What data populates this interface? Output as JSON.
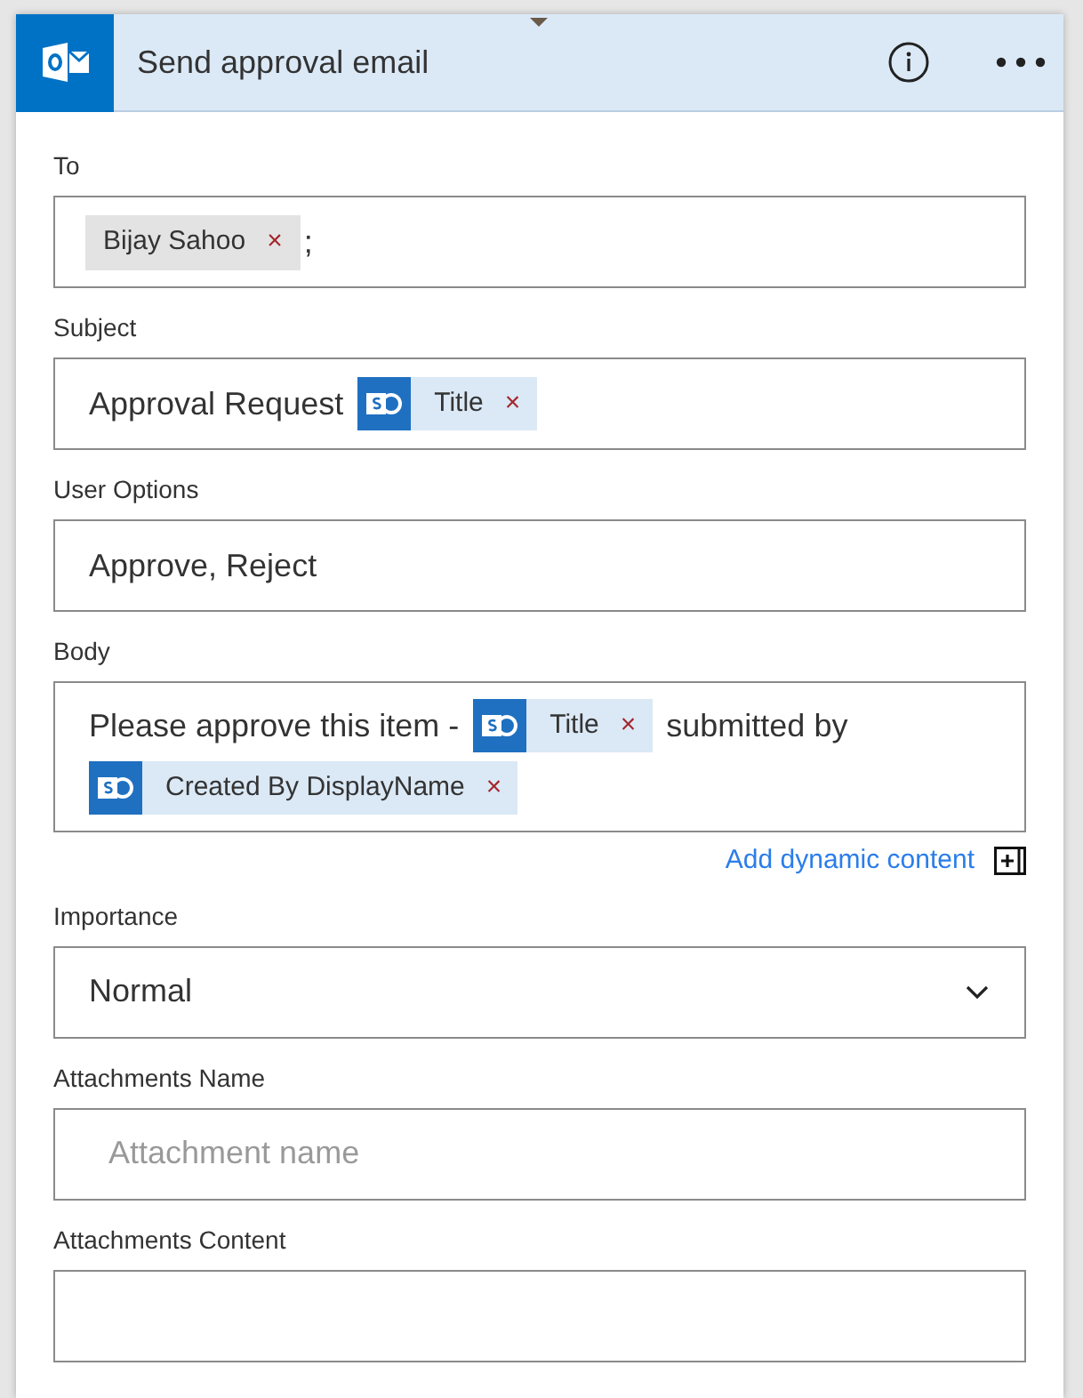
{
  "card": {
    "title": "Send approval email"
  },
  "fields": [
    {
      "label": "To",
      "kind": "tokens",
      "parts": [
        {
          "kind": "person",
          "text": "Bijay Sahoo",
          "remove": "×"
        },
        {
          "kind": "text",
          "text": ";"
        }
      ]
    },
    {
      "label": "Subject",
      "kind": "tokens",
      "parts": [
        {
          "kind": "text",
          "text": "Approval Request"
        },
        {
          "kind": "dynamic",
          "text": "Title",
          "remove": "×"
        }
      ]
    },
    {
      "label": "User Options",
      "kind": "tokens",
      "parts": [
        {
          "kind": "text",
          "text": "Approve, Reject"
        }
      ]
    },
    {
      "label": "Body",
      "kind": "tokens",
      "parts": [
        {
          "kind": "text",
          "text": "Please approve this item -"
        },
        {
          "kind": "dynamic",
          "text": "Title",
          "remove": "×"
        },
        {
          "kind": "text",
          "text": "submitted by"
        },
        {
          "kind": "dynamic",
          "text": "Created By DisplayName",
          "remove": "×"
        }
      ],
      "link": "Add dynamic content"
    },
    {
      "label": "Importance",
      "kind": "select",
      "value": "Normal"
    },
    {
      "label": "Attachments Name",
      "kind": "text",
      "placeholder": "Attachment name"
    },
    {
      "label": "Attachments Content",
      "kind": "text"
    }
  ]
}
